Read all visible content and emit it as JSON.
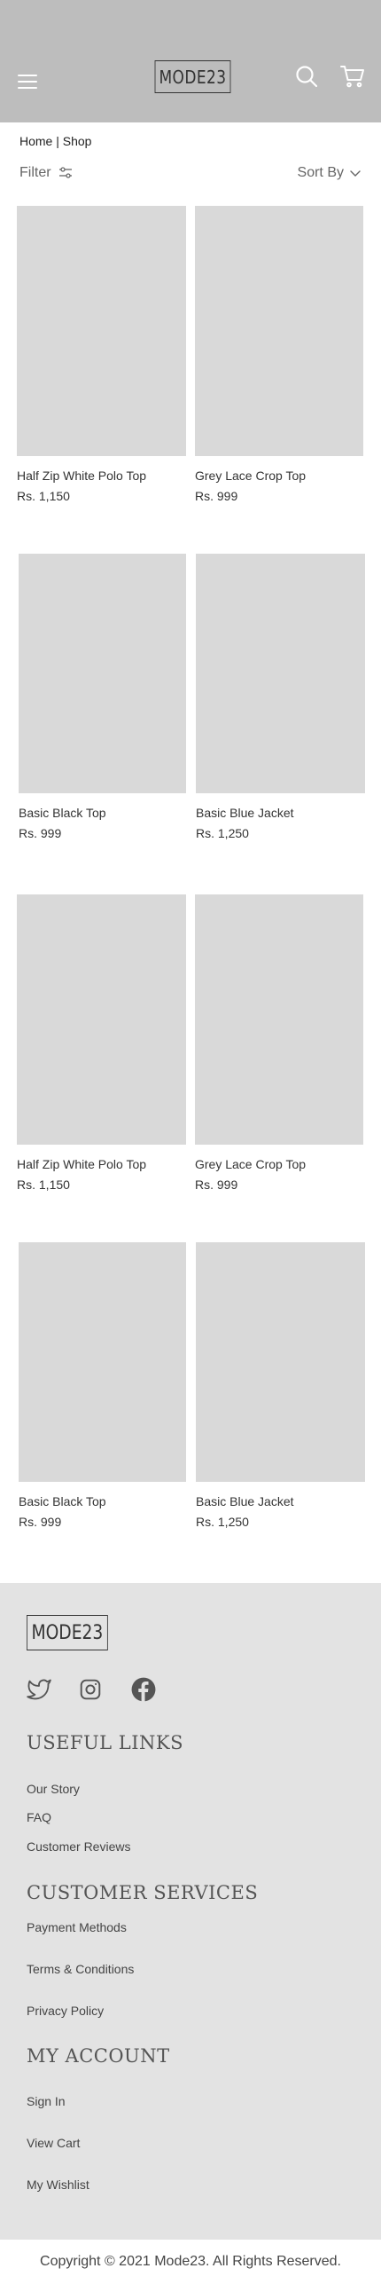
{
  "header": {
    "brand": "MODE23",
    "menu_icon": "hamburger-menu-icon",
    "search_icon": "search-icon",
    "cart_icon": "cart-icon",
    "background": "#bdbdbd"
  },
  "breadcrumb": {
    "text": "Home | Shop"
  },
  "toolbar": {
    "filter_label": "Filter",
    "filter_icon": "sliders-icon",
    "sort_label": "Sort By",
    "sort_icon": "chevron-down-icon"
  },
  "products": [
    {
      "name": "Half Zip White Polo Top",
      "price": "Rs. 1,150"
    },
    {
      "name": "Grey Lace Crop Top",
      "price": "Rs. 999"
    },
    {
      "name": "Basic Black Top",
      "price": "Rs. 999"
    },
    {
      "name": "Basic Blue Jacket",
      "price": "Rs. 1,250"
    },
    {
      "name": "Half Zip White Polo Top",
      "price": "Rs. 1,150"
    },
    {
      "name": "Grey Lace Crop Top",
      "price": "Rs. 999"
    },
    {
      "name": "Basic Black Top",
      "price": "Rs. 999"
    },
    {
      "name": "Basic Blue Jacket",
      "price": "Rs. 1,250"
    }
  ],
  "footer": {
    "brand": "MODE23",
    "social": [
      "twitter-icon",
      "instagram-icon",
      "facebook-icon"
    ],
    "useful_links": {
      "heading": "USEFUL LINKS",
      "items": [
        "Our Story",
        "FAQ",
        "Customer Reviews"
      ]
    },
    "customer_services": {
      "heading": "CUSTOMER SERVICES",
      "items": [
        "Payment Methods",
        "Terms & Conditions",
        "Privacy Policy"
      ]
    },
    "my_account": {
      "heading": "MY ACCOUNT",
      "items": [
        "Sign In",
        "View Cart",
        "My Wishlist"
      ]
    },
    "copyright": "Copyright © 2021 Mode23. All Rights Reserved.",
    "background": "#e3e3e3"
  }
}
